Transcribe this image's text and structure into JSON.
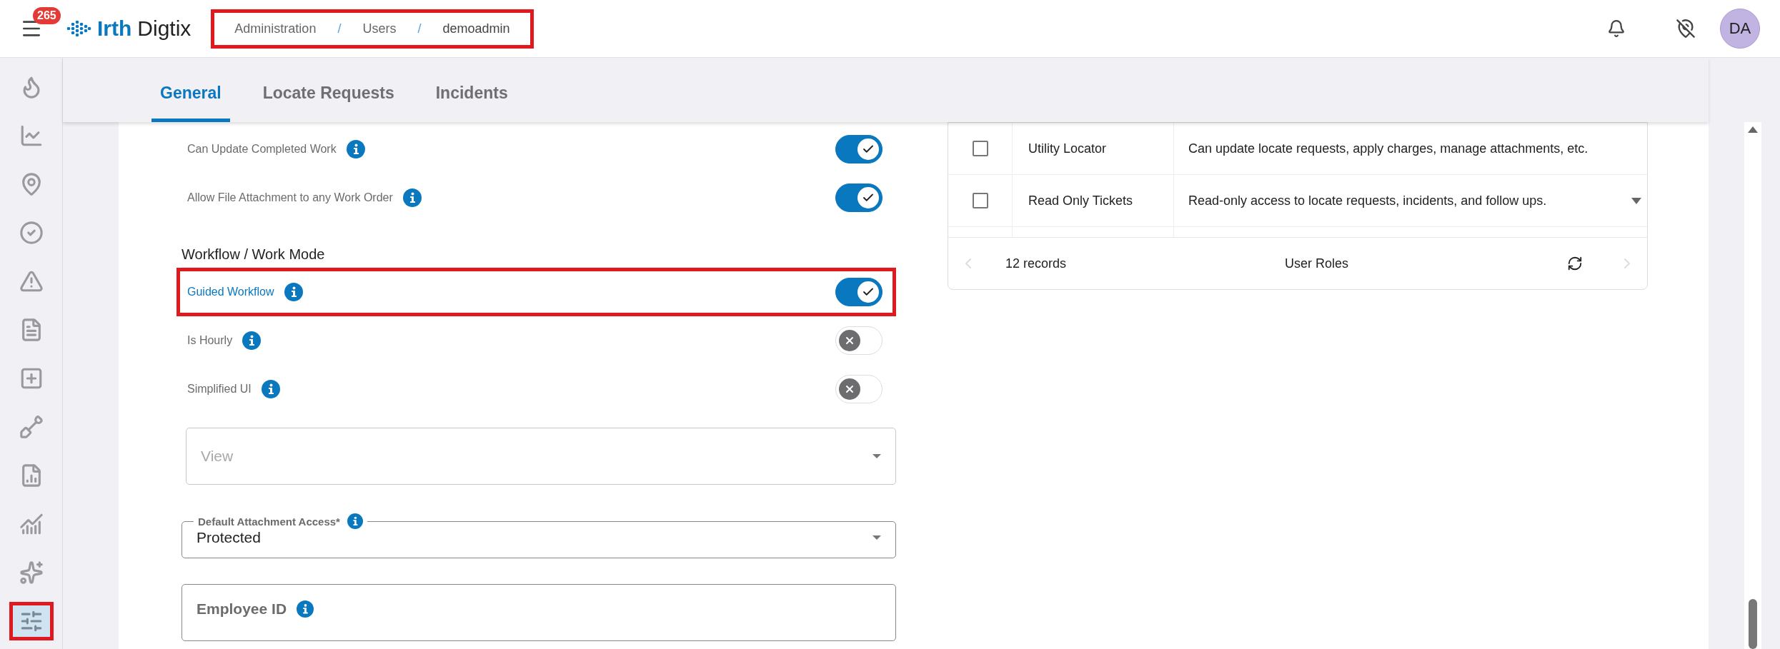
{
  "header": {
    "notification_count": "265",
    "logo_primary": "Irth",
    "logo_secondary": "Digtix",
    "avatar": "DA",
    "breadcrumb": {
      "highlighted": true,
      "items": [
        {
          "kind": "link",
          "text": "Administration"
        },
        {
          "kind": "separator",
          "text": "/"
        },
        {
          "kind": "link",
          "text": "Users"
        },
        {
          "kind": "separator",
          "text": "/"
        },
        {
          "kind": "current",
          "text": "demoadmin"
        }
      ]
    }
  },
  "sidebar": {
    "items": [
      {
        "selected": false,
        "highlighted": false
      },
      {
        "selected": false,
        "highlighted": false
      },
      {
        "selected": false,
        "highlighted": false
      },
      {
        "selected": false,
        "highlighted": false
      },
      {
        "selected": false,
        "highlighted": false
      },
      {
        "selected": false,
        "highlighted": false
      },
      {
        "selected": false,
        "highlighted": false
      },
      {
        "selected": false,
        "highlighted": false
      },
      {
        "selected": false,
        "highlighted": false
      },
      {
        "selected": false,
        "highlighted": false
      },
      {
        "selected": false,
        "highlighted": false
      },
      {
        "selected": true,
        "highlighted": true
      }
    ]
  },
  "tabs": [
    {
      "label": "General",
      "selected": true
    },
    {
      "label": "Locate Requests",
      "selected": false
    },
    {
      "label": "Incidents",
      "selected": false
    }
  ],
  "settings_top": [
    {
      "label": "Can Update Completed Work",
      "on": true,
      "highlighted": false
    },
    {
      "label": "Allow File Attachment to any Work Order",
      "on": true,
      "highlighted": false
    }
  ],
  "workflow_section": {
    "title": "Workflow / Work Mode",
    "rows": [
      {
        "label": "Guided Workflow",
        "on": true,
        "highlighted": true
      },
      {
        "label": "Is Hourly",
        "on": false,
        "highlighted": false
      },
      {
        "label": "Simplified UI",
        "on": false,
        "highlighted": false
      }
    ]
  },
  "view_select": {
    "placeholder": "View"
  },
  "attachment_select": {
    "label": "Default Attachment Access*",
    "value": "Protected"
  },
  "employee_id": {
    "label": "Employee ID"
  },
  "roles_table": {
    "rows": [
      {
        "checked": false,
        "name": "Utility Locator",
        "description": "Can update locate requests, apply charges, manage attachments, etc."
      },
      {
        "checked": false,
        "name": "Read Only Tickets",
        "description": "Read-only access to locate requests, incidents, and follow ups."
      }
    ],
    "footer": {
      "count": "12 records",
      "title": "User Roles"
    }
  }
}
